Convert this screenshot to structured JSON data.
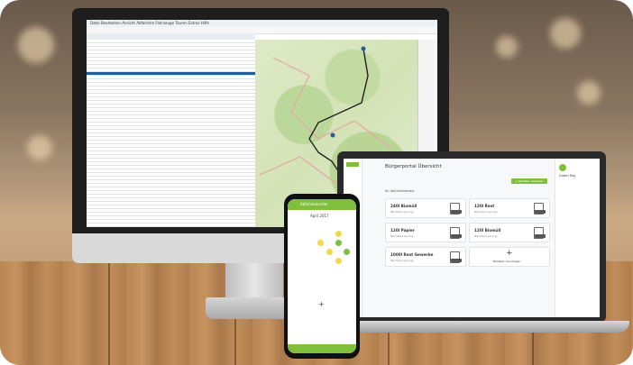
{
  "monitor_app": {
    "menu_text": "Datei  Bearbeiten  Ansicht  Abfahrten  Fahrzeuge  Touren  Extras  Hilfe"
  },
  "laptop_app": {
    "title": "Bürgerportal Übersicht",
    "section_label": "Ihr Abfuhrkalender",
    "action_button": "+ Behälter bestellen",
    "greeting": "Guten Tag",
    "cards": [
      {
        "title": "240l Biomüll",
        "subtitle": "Nächste Leerung"
      },
      {
        "title": "120l Rest",
        "subtitle": "Nächste Leerung"
      },
      {
        "title": "120l Papier",
        "subtitle": "Nächste Leerung"
      },
      {
        "title": "120l Biomüll",
        "subtitle": "Nächste Leerung"
      },
      {
        "title": "1000l Rest Gewerbe",
        "subtitle": "Nächste Leerung"
      },
      {
        "title": "Behälter hinzufügen",
        "subtitle": ""
      }
    ]
  },
  "phone_app": {
    "header": "Abfuhrkalender",
    "month": "April 2017"
  },
  "colors": {
    "accent": "#7fbf3c",
    "selection": "#1e5f9a"
  }
}
